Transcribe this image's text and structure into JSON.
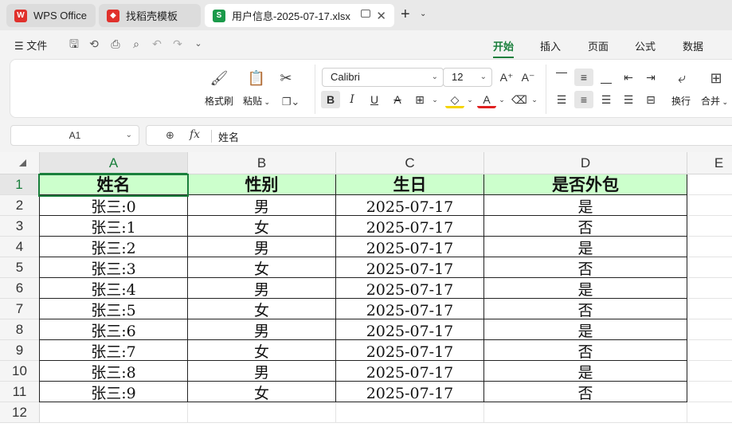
{
  "tabs": [
    {
      "label": "WPS Office",
      "icon": "wps-logo-icon",
      "color": "#e0312c"
    },
    {
      "label": "找稻壳模板",
      "icon": "docer-icon",
      "color": "#e0312c"
    },
    {
      "label": "用户信息-2025-07-17.xlsx",
      "icon": "sheet-icon",
      "icon_text": "S",
      "color": "#1a9a4a"
    }
  ],
  "menu": {
    "file_label": "文件",
    "ribbon_tabs": [
      "开始",
      "插入",
      "页面",
      "公式",
      "数据"
    ],
    "active_tab": "开始"
  },
  "ribbon": {
    "format_painter": "格式刷",
    "paste": "粘贴",
    "font_name": "Calibri",
    "font_size": "12",
    "wrap": "换行",
    "merge": "合并"
  },
  "formula_bar": {
    "cell_ref": "A1",
    "fx": "fx",
    "content": "姓名"
  },
  "sheet": {
    "columns": [
      "A",
      "B",
      "C",
      "D",
      "E"
    ],
    "row_numbers": [
      "1",
      "2",
      "3",
      "4",
      "5",
      "6",
      "7",
      "8",
      "9",
      "10",
      "11",
      "12"
    ],
    "header": [
      "姓名",
      "性别",
      "生日",
      "是否外包"
    ],
    "rows": [
      [
        "张三:0",
        "男",
        "2025-07-17",
        "是"
      ],
      [
        "张三:1",
        "女",
        "2025-07-17",
        "否"
      ],
      [
        "张三:2",
        "男",
        "2025-07-17",
        "是"
      ],
      [
        "张三:3",
        "女",
        "2025-07-17",
        "否"
      ],
      [
        "张三:4",
        "男",
        "2025-07-17",
        "是"
      ],
      [
        "张三:5",
        "女",
        "2025-07-17",
        "否"
      ],
      [
        "张三:6",
        "男",
        "2025-07-17",
        "是"
      ],
      [
        "张三:7",
        "女",
        "2025-07-17",
        "否"
      ],
      [
        "张三:8",
        "男",
        "2025-07-17",
        "是"
      ],
      [
        "张三:9",
        "女",
        "2025-07-17",
        "否"
      ]
    ],
    "selected_cell": "A1",
    "header_fill": "#ccffcc",
    "accent": "#1a7f3c"
  }
}
